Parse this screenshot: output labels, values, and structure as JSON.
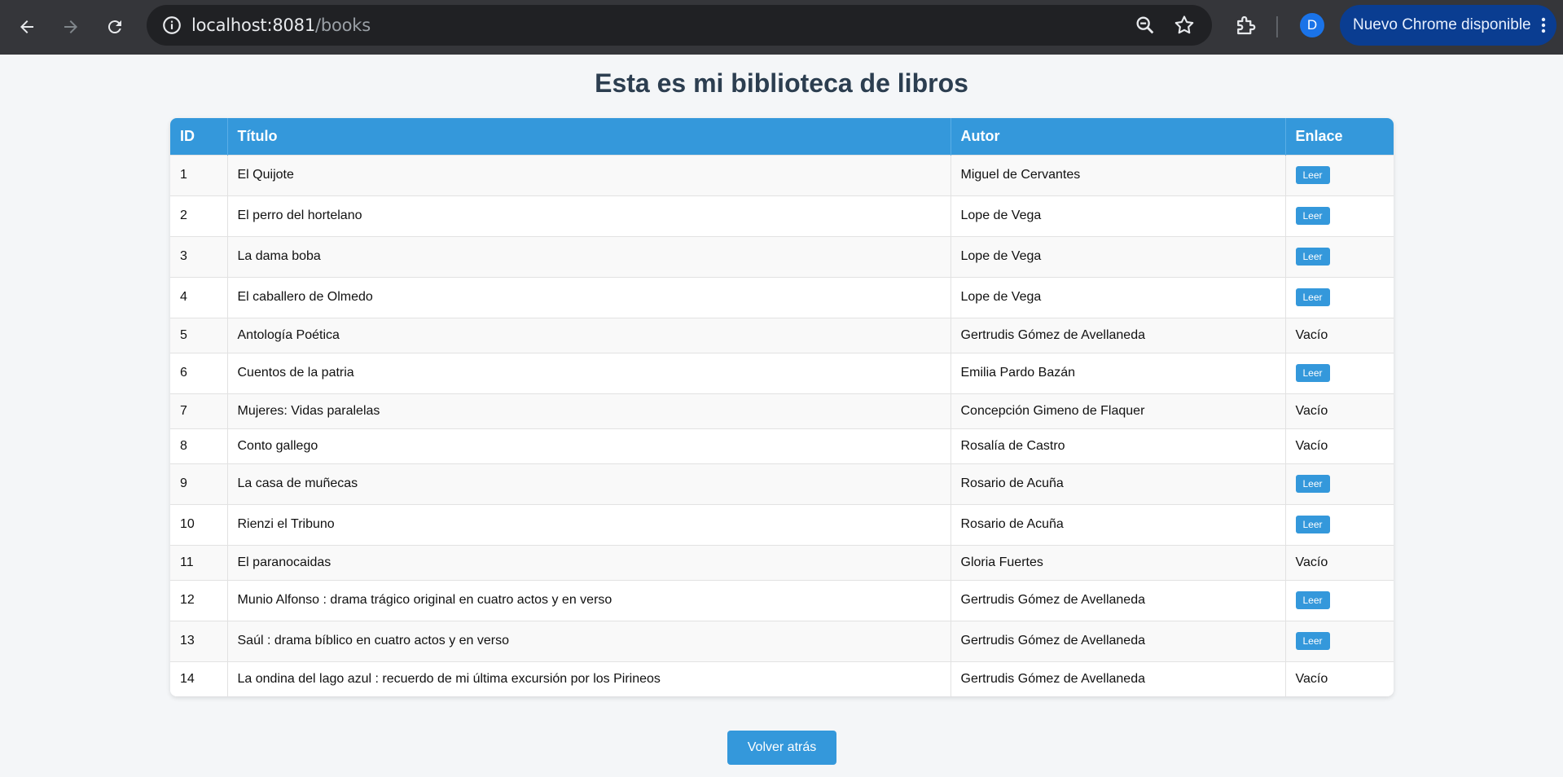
{
  "browser": {
    "url_host": "localhost:8081",
    "url_path": "/books",
    "profile_initial": "D",
    "update_label": "Nuevo Chrome disponible",
    "colors": {
      "chrome_bg": "#35363a",
      "omnibox_bg": "#202124",
      "profile": "#1a73e8"
    }
  },
  "page": {
    "title": "Esta es mi biblioteca de libros",
    "back_label": "Volver atrás",
    "accent": "#3498db"
  },
  "table": {
    "headers": {
      "id": "ID",
      "title": "Título",
      "author": "Autor",
      "link": "Enlace"
    },
    "rows": [
      {
        "id": "1",
        "title": "El Quijote",
        "author": "Miguel de Cervantes",
        "link": "Leer"
      },
      {
        "id": "2",
        "title": "El perro del hortelano",
        "author": "Lope de Vega",
        "link": "Leer"
      },
      {
        "id": "3",
        "title": "La dama boba",
        "author": "Lope de Vega",
        "link": "Leer"
      },
      {
        "id": "4",
        "title": "El caballero de Olmedo",
        "author": "Lope de Vega",
        "link": "Leer"
      },
      {
        "id": "5",
        "title": "Antología Poética",
        "author": "Gertrudis Gómez de Avellaneda",
        "link": "Vacío"
      },
      {
        "id": "6",
        "title": "Cuentos de la patria",
        "author": "Emilia Pardo Bazán",
        "link": "Leer"
      },
      {
        "id": "7",
        "title": "Mujeres: Vidas paralelas",
        "author": "Concepción Gimeno de Flaquer",
        "link": "Vacío"
      },
      {
        "id": "8",
        "title": "Conto gallego",
        "author": "Rosalía de Castro",
        "link": "Vacío"
      },
      {
        "id": "9",
        "title": "La casa de muñecas",
        "author": "Rosario de Acuña",
        "link": "Leer"
      },
      {
        "id": "10",
        "title": "Rienzi el Tribuno",
        "author": "Rosario de Acuña",
        "link": "Leer"
      },
      {
        "id": "11",
        "title": "El paranocaidas",
        "author": "Gloria Fuertes",
        "link": "Vacío"
      },
      {
        "id": "12",
        "title": "Munio Alfonso : drama trágico original en cuatro actos y en verso",
        "author": "Gertrudis Gómez de Avellaneda",
        "link": "Leer"
      },
      {
        "id": "13",
        "title": "Saúl : drama bíblico en cuatro actos y en verso",
        "author": "Gertrudis Gómez de Avellaneda",
        "link": "Leer"
      },
      {
        "id": "14",
        "title": "La ondina del lago azul : recuerdo de mi última excursión por los Pirineos",
        "author": "Gertrudis Gómez de Avellaneda",
        "link": "Vacío"
      }
    ]
  }
}
